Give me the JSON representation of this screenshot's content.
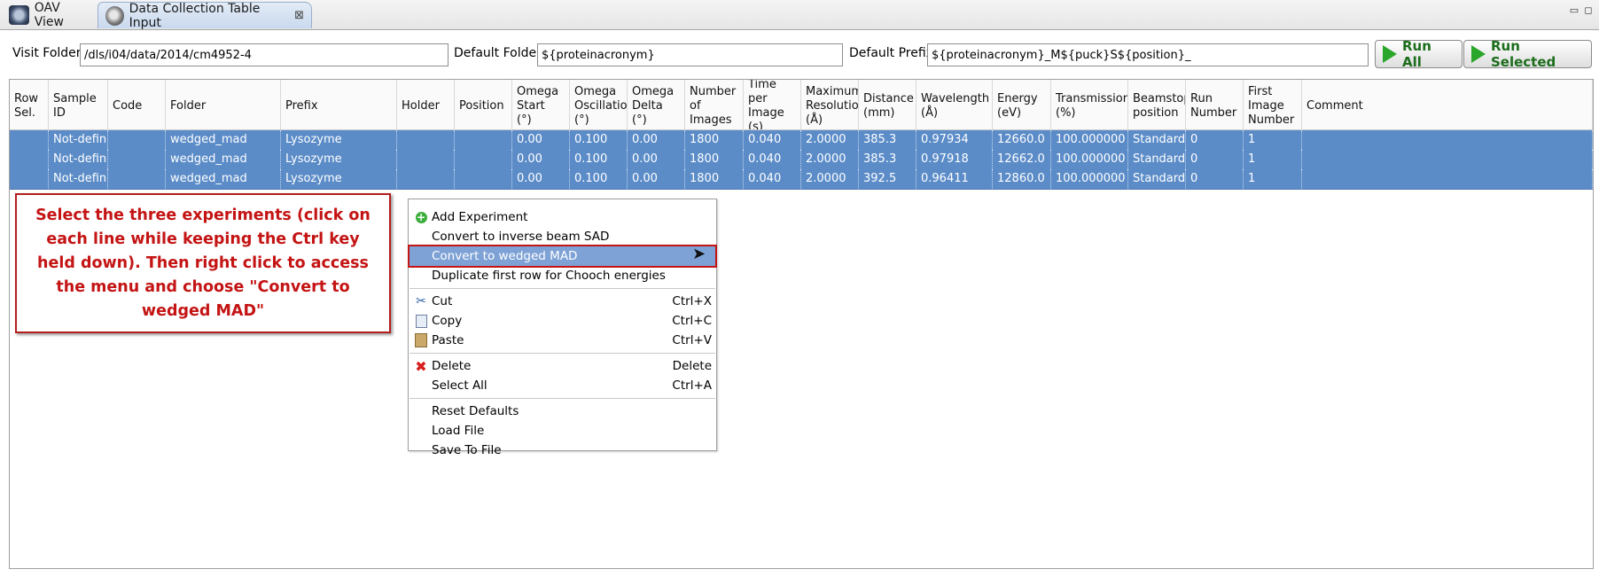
{
  "tabs": [
    {
      "label": "OAV View",
      "icon": "camera-view-icon"
    },
    {
      "label": "Data Collection Table Input",
      "icon": "dial-icon",
      "close": "⊠"
    }
  ],
  "window_controls": {
    "minimize": "▭",
    "maximize": "◻"
  },
  "toolbar": {
    "visit_folder_label": "Visit Folder",
    "visit_folder_value": "/dls/i04/data/2014/cm4952-4",
    "default_folder_label": "Default Folder",
    "default_folder_value": "${proteinacronym}",
    "default_prefix_label": "Default Prefix",
    "default_prefix_value": "${proteinacronym}_M${puck}S${position}_",
    "run_all_label": "Run All",
    "run_selected_label": "Run Selected"
  },
  "table": {
    "columns": [
      "Row\nSel.",
      "Sample\nID",
      "Code",
      "Folder",
      "Prefix",
      "Holder",
      "Position",
      "Omega\nStart\n(°)",
      "Omega\nOscillation\n(°)",
      "Omega\nDelta\n(°)",
      "Number\nof\nImages",
      "Time per\nImage\n(s)",
      "Maximum\nResolution\n(Å)",
      "Distance\n(mm)",
      "Wavelength\n(Å)",
      "Energy\n(eV)",
      "Transmission\n(%)",
      "Beamstop\nposition",
      "Run\nNumber",
      "First\nImage\nNumber",
      "Comment"
    ],
    "rows": [
      [
        "",
        "Not-defined",
        "",
        "wedged_mad",
        "Lysozyme",
        "",
        "",
        "0.00",
        "0.100",
        "0.00",
        "1800",
        "0.040",
        "2.0000",
        "385.3",
        "0.97934",
        "12660.0",
        "100.000000",
        "Standard",
        "0",
        "1",
        ""
      ],
      [
        "",
        "Not-defined",
        "",
        "wedged_mad",
        "Lysozyme",
        "",
        "",
        "0.00",
        "0.100",
        "0.00",
        "1800",
        "0.040",
        "2.0000",
        "385.3",
        "0.97918",
        "12662.0",
        "100.000000",
        "Standard",
        "0",
        "1",
        ""
      ],
      [
        "",
        "Not-defined",
        "",
        "wedged_mad",
        "Lysozyme",
        "",
        "",
        "0.00",
        "0.100",
        "0.00",
        "1800",
        "0.040",
        "2.0000",
        "392.5",
        "0.96411",
        "12860.0",
        "100.000000",
        "Standard",
        "0",
        "1",
        ""
      ]
    ]
  },
  "callout": {
    "text": "Select the three experiments (click on each line while keeping the Ctrl key held down). Then right click to access the menu and choose  \"Convert to wedged MAD\""
  },
  "context_menu": {
    "items": [
      {
        "label": "Add Experiment",
        "shortcut": "",
        "icon": "add-icon"
      },
      {
        "label": "Convert to inverse beam SAD",
        "shortcut": "",
        "icon": ""
      },
      {
        "label": "Convert to wedged MAD",
        "shortcut": "",
        "icon": "",
        "highlighted": true
      },
      {
        "label": "Duplicate first row for Chooch energies",
        "shortcut": "",
        "icon": ""
      },
      {
        "label": "Cut",
        "shortcut": "Ctrl+X",
        "icon": "scissors-icon"
      },
      {
        "label": "Copy",
        "shortcut": "Ctrl+C",
        "icon": "copy-icon"
      },
      {
        "label": "Paste",
        "shortcut": "Ctrl+V",
        "icon": "paste-icon"
      },
      {
        "label": "Delete",
        "shortcut": "Delete",
        "icon": "delete-icon"
      },
      {
        "label": "Select All",
        "shortcut": "Ctrl+A",
        "icon": ""
      },
      {
        "label": "Reset Defaults",
        "shortcut": "",
        "icon": ""
      },
      {
        "label": "Load File",
        "shortcut": "",
        "icon": ""
      },
      {
        "label": "Save To File",
        "shortcut": "",
        "icon": ""
      }
    ]
  },
  "colors": {
    "selection": "#5b8cc8",
    "menu_highlight": "#7ea2d6",
    "annotation_red": "#c41414",
    "run_green": "#2aa62a"
  }
}
